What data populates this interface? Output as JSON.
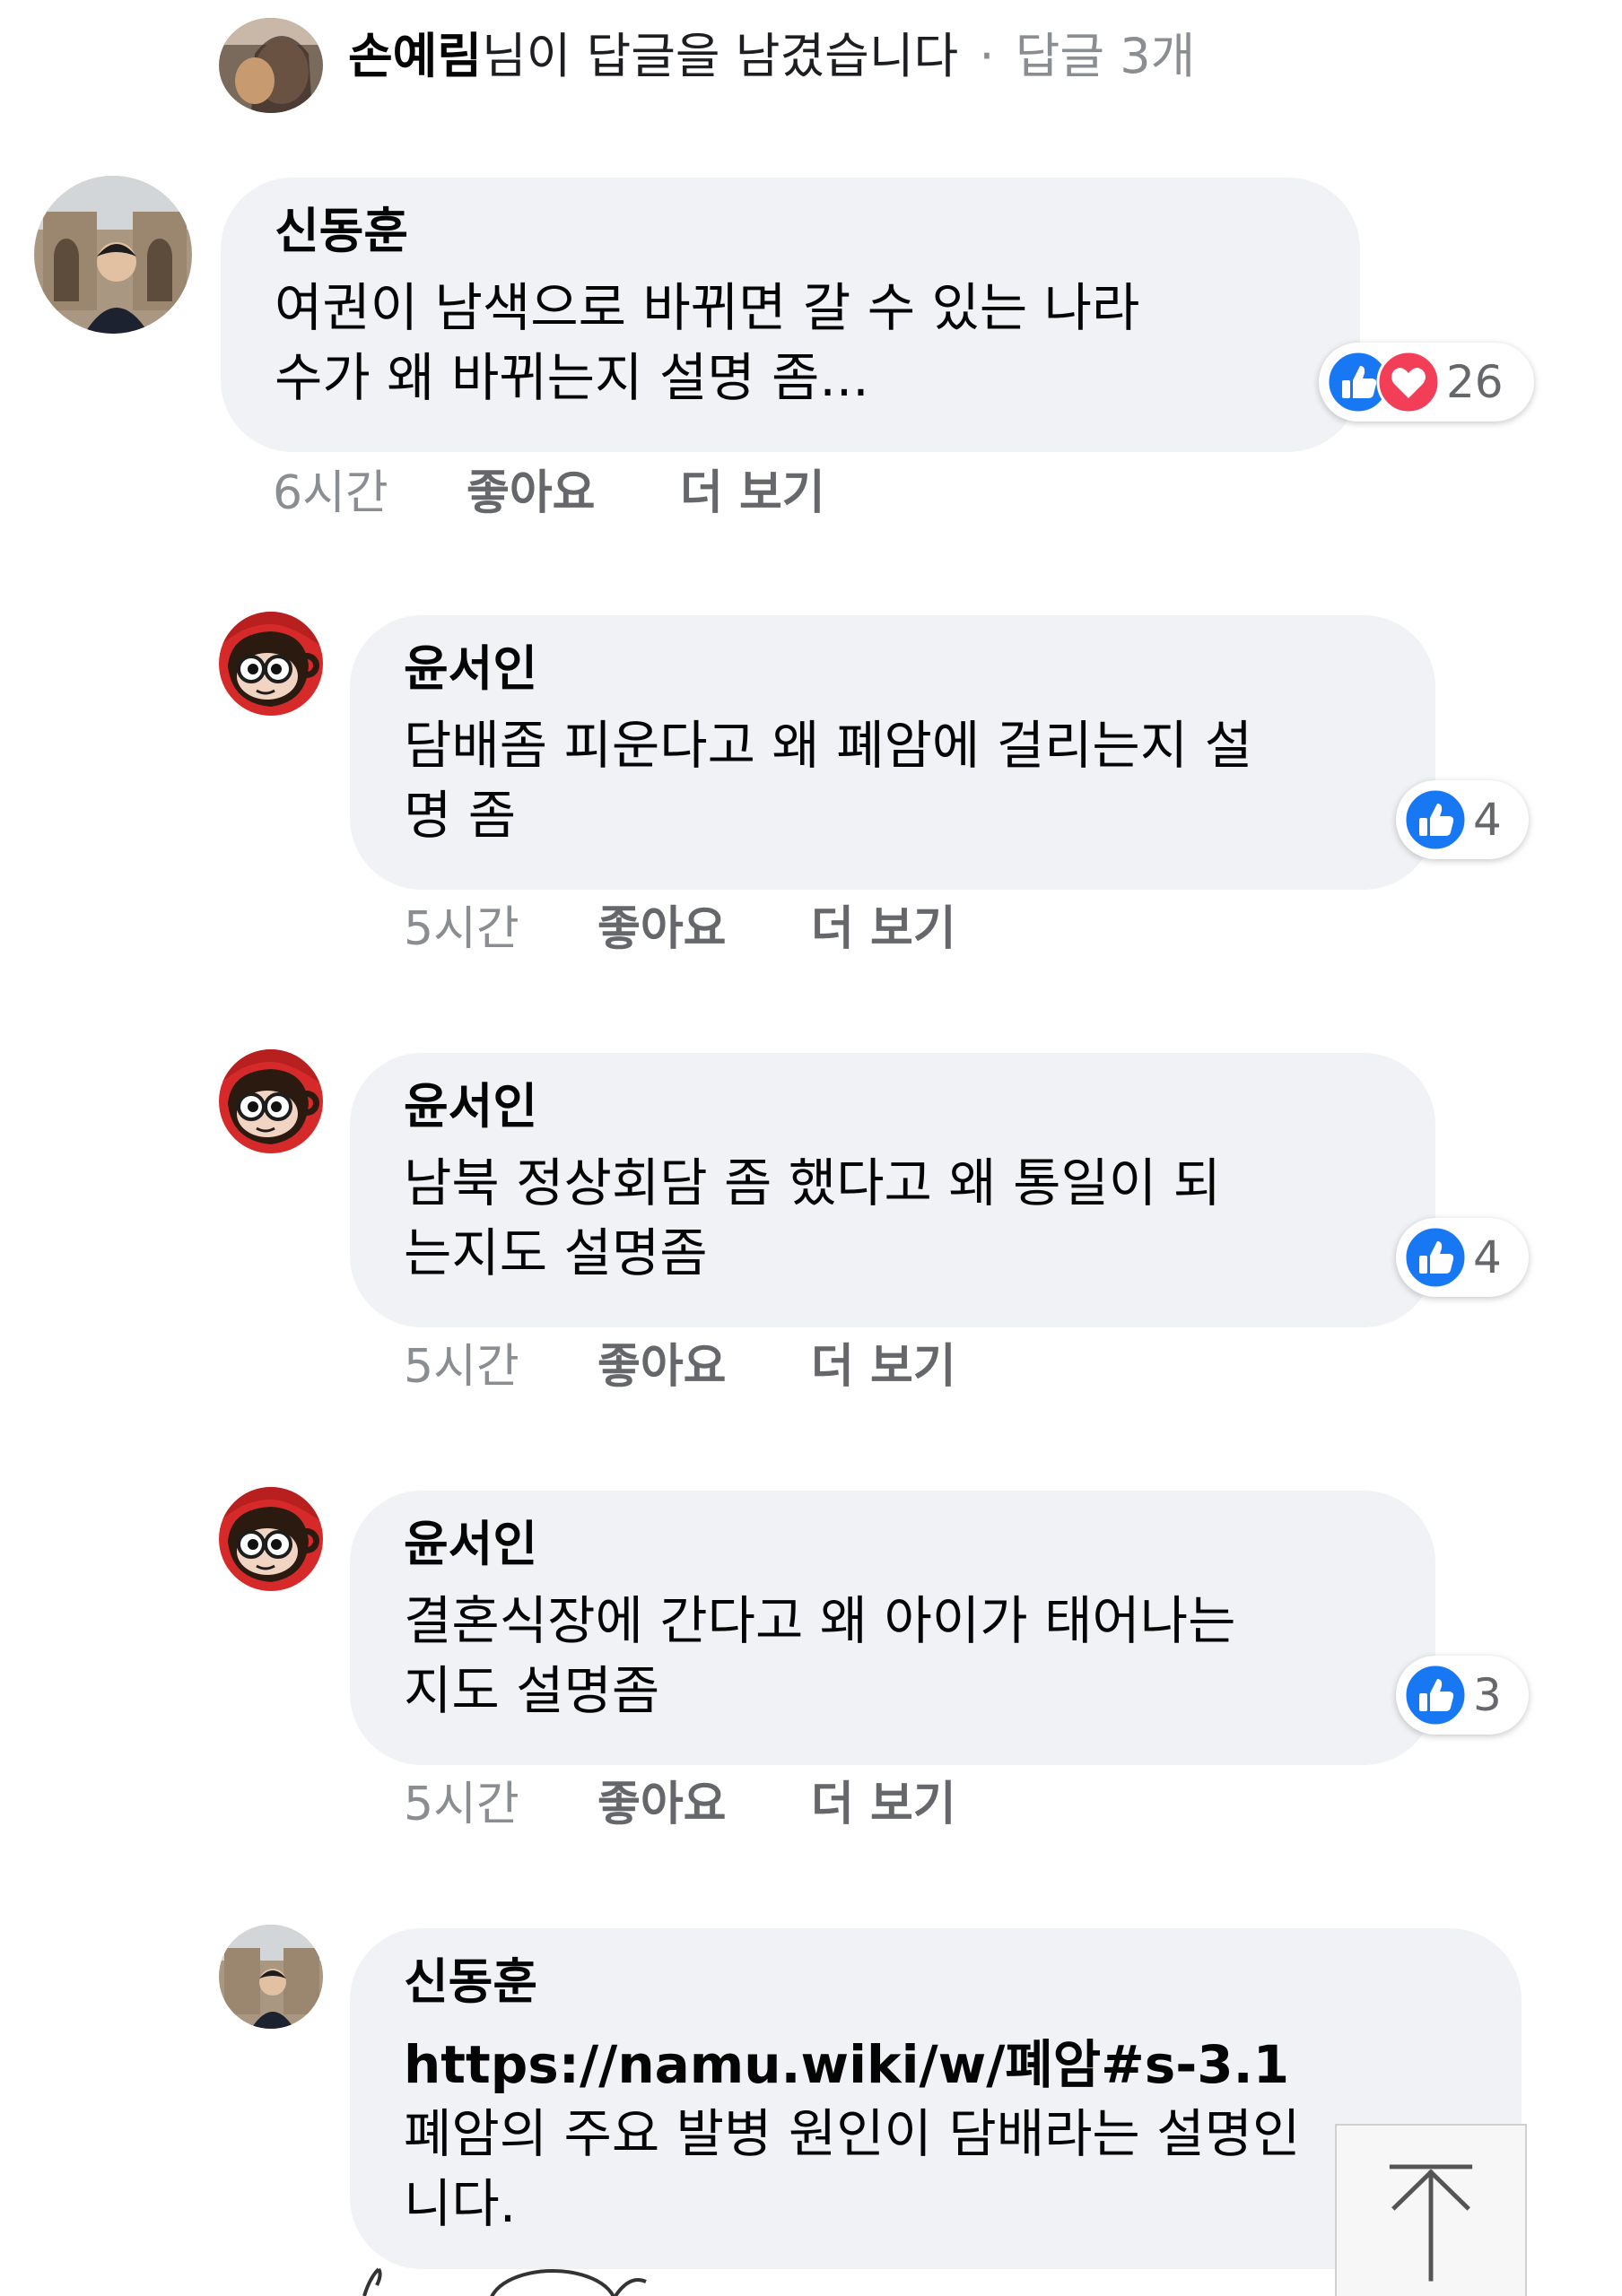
{
  "notice": {
    "name": "손예림",
    "text": "님이 답글을 남겼습니다",
    "separator": "·",
    "replies": "답글 3개"
  },
  "comment": {
    "author": "신동훈",
    "text": "여권이 남색으로 바뀌면 갈 수 있는 나라\n수가 왜 바뀌는지 설명 좀...",
    "reactions": [
      "like-icon",
      "love-icon"
    ],
    "reaction_count": "26",
    "time": "6시간",
    "like_label": "좋아요",
    "more_label": "더 보기"
  },
  "replies": [
    {
      "author": "윤서인",
      "text": "담배좀 피운다고 왜 폐암에 걸리는지 설\n명 좀",
      "reaction_count": "4",
      "time": "5시간",
      "like_label": "좋아요",
      "more_label": "더 보기"
    },
    {
      "author": "윤서인",
      "text": "남북 정상회담 좀 했다고 왜 통일이 되\n는지도 설명좀",
      "reaction_count": "4",
      "time": "5시간",
      "like_label": "좋아요",
      "more_label": "더 보기"
    },
    {
      "author": "윤서인",
      "text": "결혼식장에 간다고 왜 아이가 태어나는\n지도 설명좀",
      "reaction_count": "3",
      "time": "5시간",
      "like_label": "좋아요",
      "more_label": "더 보기"
    },
    {
      "author": "신동훈",
      "link": "https://namu.wiki/w/폐암#s-3.1",
      "text": "폐암의 주요 발병 원인이 담배라는 설명인\n니다."
    }
  ],
  "colors": {
    "bubble": "#f0f2f5",
    "like_blue": "#1877f2",
    "love_red": "#f33e58",
    "meta_gray": "#65676b"
  }
}
